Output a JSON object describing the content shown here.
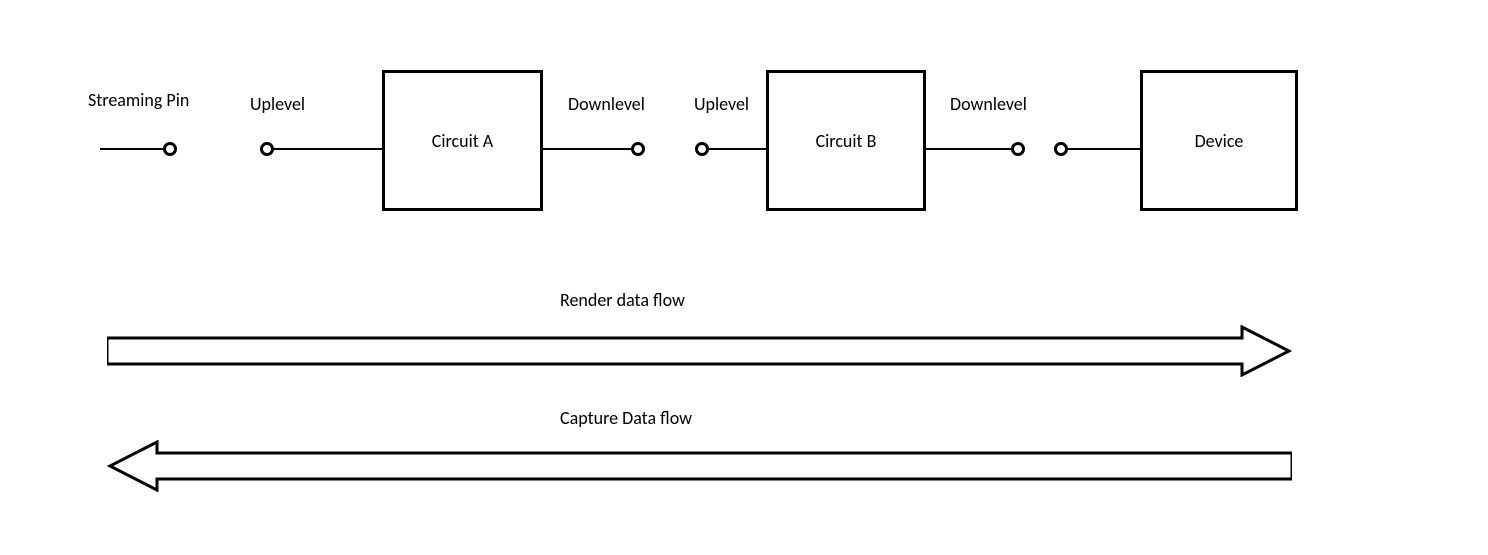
{
  "labels": {
    "streaming_pin": "Streaming Pin",
    "uplevel_1": "Uplevel",
    "circuit_a": "Circuit A",
    "downlevel_1": "Downlevel",
    "uplevel_2": "Uplevel",
    "circuit_b": "Circuit B",
    "downlevel_2": "Downlevel",
    "device": "Device",
    "render_flow": "Render data flow",
    "capture_flow": "Capture Data flow"
  }
}
